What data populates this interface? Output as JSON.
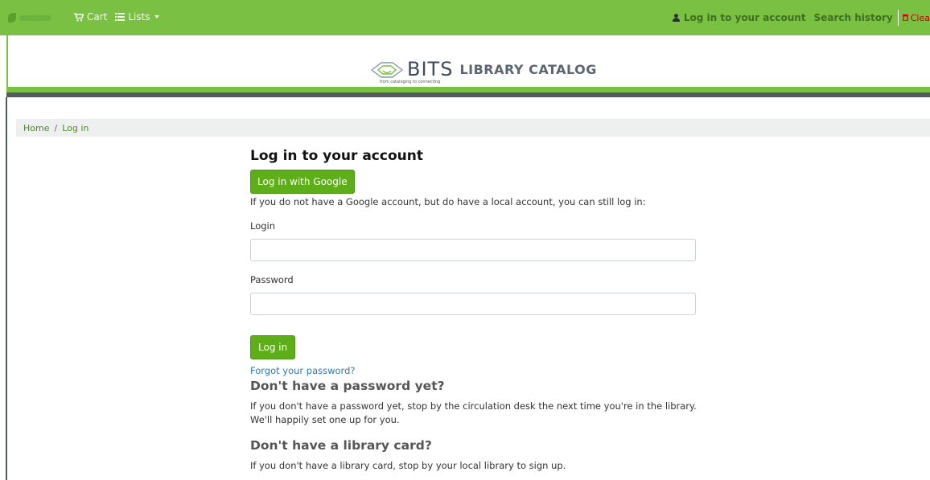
{
  "topbar": {
    "cart_label": "Cart",
    "lists_label": "Lists",
    "login_link": "Log in to your account",
    "search_history": "Search history",
    "clear_label": "Clea"
  },
  "header": {
    "brand_text": "BITS",
    "brand_tagline": "from cataloging   to connecting",
    "catalog_title": "LIBRARY CATALOG"
  },
  "breadcrumb": {
    "items": [
      "Home",
      "Log in"
    ],
    "separator": "/"
  },
  "main": {
    "title": "Log in to your account",
    "google_button": "Log in with Google",
    "google_note": "If you do not have a Google account, but do have a local account, you can still log in:",
    "login_label": "Login",
    "login_value": "",
    "password_label": "Password",
    "password_value": "",
    "login_button": "Log in",
    "forgot_link": "Forgot your password?",
    "no_password_heading": "Don't have a password yet?",
    "no_password_text": "If you don't have a password yet, stop by the circulation desk the next time you're in the library. We'll happily set one up for you.",
    "no_card_heading": "Don't have a library card?",
    "no_card_text": "If you don't have a library card, stop by your local library to sign up."
  },
  "colors": {
    "brand_green": "#7ac143",
    "button_green": "#5eae1a",
    "link_blue": "#2f79ad",
    "dark_strip": "#555b61"
  },
  "icons": {
    "cart": "cart-icon",
    "lists": "list-icon",
    "user": "user-icon",
    "clear": "trash-icon"
  }
}
